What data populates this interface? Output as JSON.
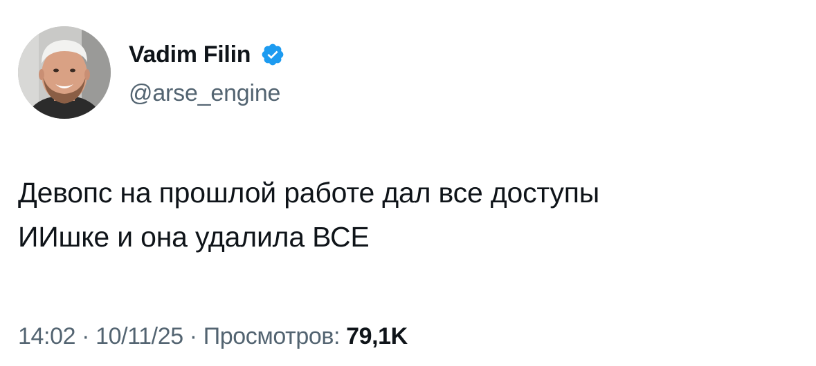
{
  "author": {
    "display_name": "Vadim Filin",
    "handle": "@arse_engine",
    "verified": true,
    "verified_color": "#1d9bf0",
    "avatar_icon": "user-avatar-photo"
  },
  "tweet": {
    "text": "Девопс на прошлой работе дал все доступы\nИИшке и она удалила ВСЕ"
  },
  "meta": {
    "time": "14:02",
    "separator": " · ",
    "date": "10/11/25",
    "views_label": "Просмотров: ",
    "views_count": "79,1K"
  }
}
